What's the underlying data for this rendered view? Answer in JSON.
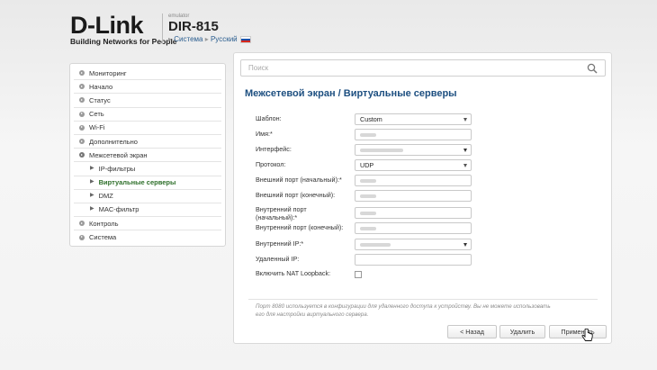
{
  "header": {
    "brand": "D-Link",
    "tagline": "Building Networks for People",
    "emulator_label": "emulator",
    "model": "DIR-815",
    "crumb_system": "Система",
    "crumb_language": "Русский"
  },
  "sidebar": {
    "items": [
      {
        "label": "Мониторинг"
      },
      {
        "label": "Начало"
      },
      {
        "label": "Статус"
      },
      {
        "label": "Сеть"
      },
      {
        "label": "Wi-Fi"
      },
      {
        "label": "Дополнительно"
      },
      {
        "label": "Межсетевой экран"
      },
      {
        "label": "IP-фильтры"
      },
      {
        "label": "Виртуальные серверы"
      },
      {
        "label": "DMZ"
      },
      {
        "label": "MAC-фильтр"
      },
      {
        "label": "Контроль"
      },
      {
        "label": "Система"
      }
    ]
  },
  "search": {
    "placeholder": "Поиск"
  },
  "page": {
    "title": "Межсетевой экран /  Виртуальные серверы"
  },
  "form": {
    "template_label": "Шаблон:",
    "template_value": "Custom",
    "name_label": "Имя:*",
    "interface_label": "Интерфейс:",
    "protocol_label": "Протокол:",
    "protocol_value": "UDP",
    "ext_port_start_label": "Внешний порт (начальный):*",
    "ext_port_end_label": "Внешний порт (конечный):",
    "int_port_start_label": "Внутренний порт (начальный):*",
    "int_port_end_label": "Внутренний порт (конечный):",
    "internal_ip_label": "Внутренний IP:*",
    "remote_ip_label": "Удаленный IP:",
    "nat_loopback_label": "Включить NAT Loopback:"
  },
  "note": "Порт 8080 используется в конфигурации для удаленного доступа к устройству. Вы не можете использовать его для настройки виртуального сервера.",
  "buttons": {
    "back": "< Назад",
    "delete": "Удалить",
    "apply": "Применить"
  }
}
